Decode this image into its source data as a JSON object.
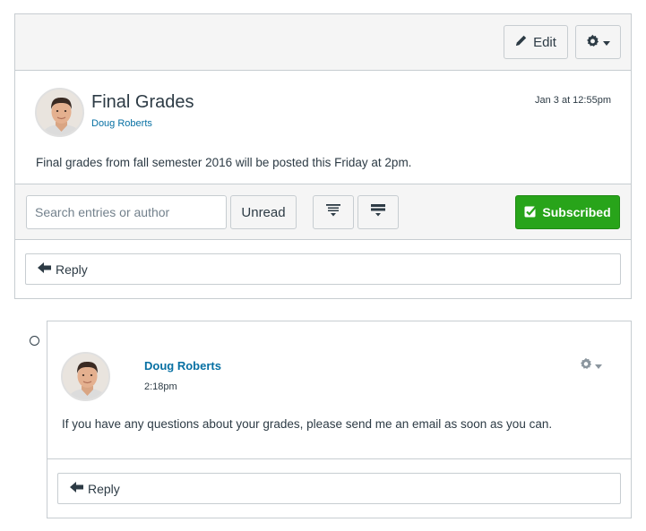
{
  "toolbar": {
    "edit_label": "Edit",
    "edit_icon": "pencil-icon",
    "settings_icon": "gear-icon"
  },
  "topic": {
    "title": "Final Grades",
    "author": "Doug Roberts",
    "date": "Jan 3 at 12:55pm",
    "message": "Final grades from fall semester 2016 will be posted this Friday at 2pm."
  },
  "filters": {
    "search_placeholder": "Search entries or author",
    "unread_label": "Unread",
    "expand_icon": "expand-all-icon",
    "collapse_icon": "collapse-all-icon",
    "subscribed_label": "Subscribed",
    "subscribed_color": "#28a41a"
  },
  "topic_reply": {
    "label": "Reply"
  },
  "entry": {
    "author": "Doug Roberts",
    "time": "2:18pm",
    "message": "If you have any questions about your grades, please send me an email as soon as you can.",
    "reply_label": "Reply"
  },
  "colors": {
    "link": "#0770a3",
    "text": "#2d3b45",
    "border": "#c7cdd1",
    "toolbar_bg": "#f5f5f5"
  }
}
